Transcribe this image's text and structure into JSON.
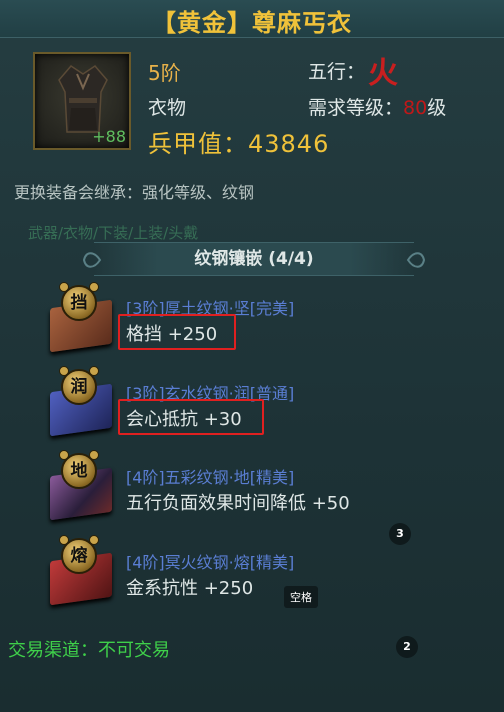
{
  "item": {
    "title": "【黄金】尊麻丐衣",
    "enhance": "+88",
    "grade": "5阶",
    "slot": "衣物",
    "armor_label": "兵甲值：",
    "armor_value": "43846",
    "element_label": "五行：",
    "element_glyph": "火",
    "req_label": "需求等级：",
    "req_value": "80",
    "req_suffix": "级",
    "inherit_note": "更换装备会继承：强化等级、纹钢"
  },
  "tabs_ghost": "武器/衣物/下装/上装/头戴",
  "section": {
    "title": "纹钢镶嵌 (4/4)"
  },
  "gems": [
    {
      "badge": "挡",
      "name": "[3阶]厚土纹钢·坚[完美]",
      "stat": "格挡 +250",
      "color": "#8a4a32"
    },
    {
      "badge": "润",
      "name": "[3阶]玄水纹钢·润[普通]",
      "stat": "会心抵抗 +30",
      "color": "#3a4a9a"
    },
    {
      "badge": "地",
      "name": "[4阶]五彩纹钢·地[精美]",
      "stat": "五行负面效果时间降低 +50",
      "color": "#6a4a7a"
    },
    {
      "badge": "熔",
      "name": "[4阶]冥火纹钢·熔[精美]",
      "stat": "金系抗性 +250",
      "color": "#a02a2a"
    }
  ],
  "overlays": {
    "badge_3": "3",
    "badge_2": "2",
    "space_label": "空格"
  },
  "trade_note": "交易渠道：不可交易",
  "colors": {
    "gold": "#f0c23a",
    "gem_name_blue": "#5a7ed3",
    "trade_green": "#3fd04a",
    "highlight_red": "#e02020"
  }
}
